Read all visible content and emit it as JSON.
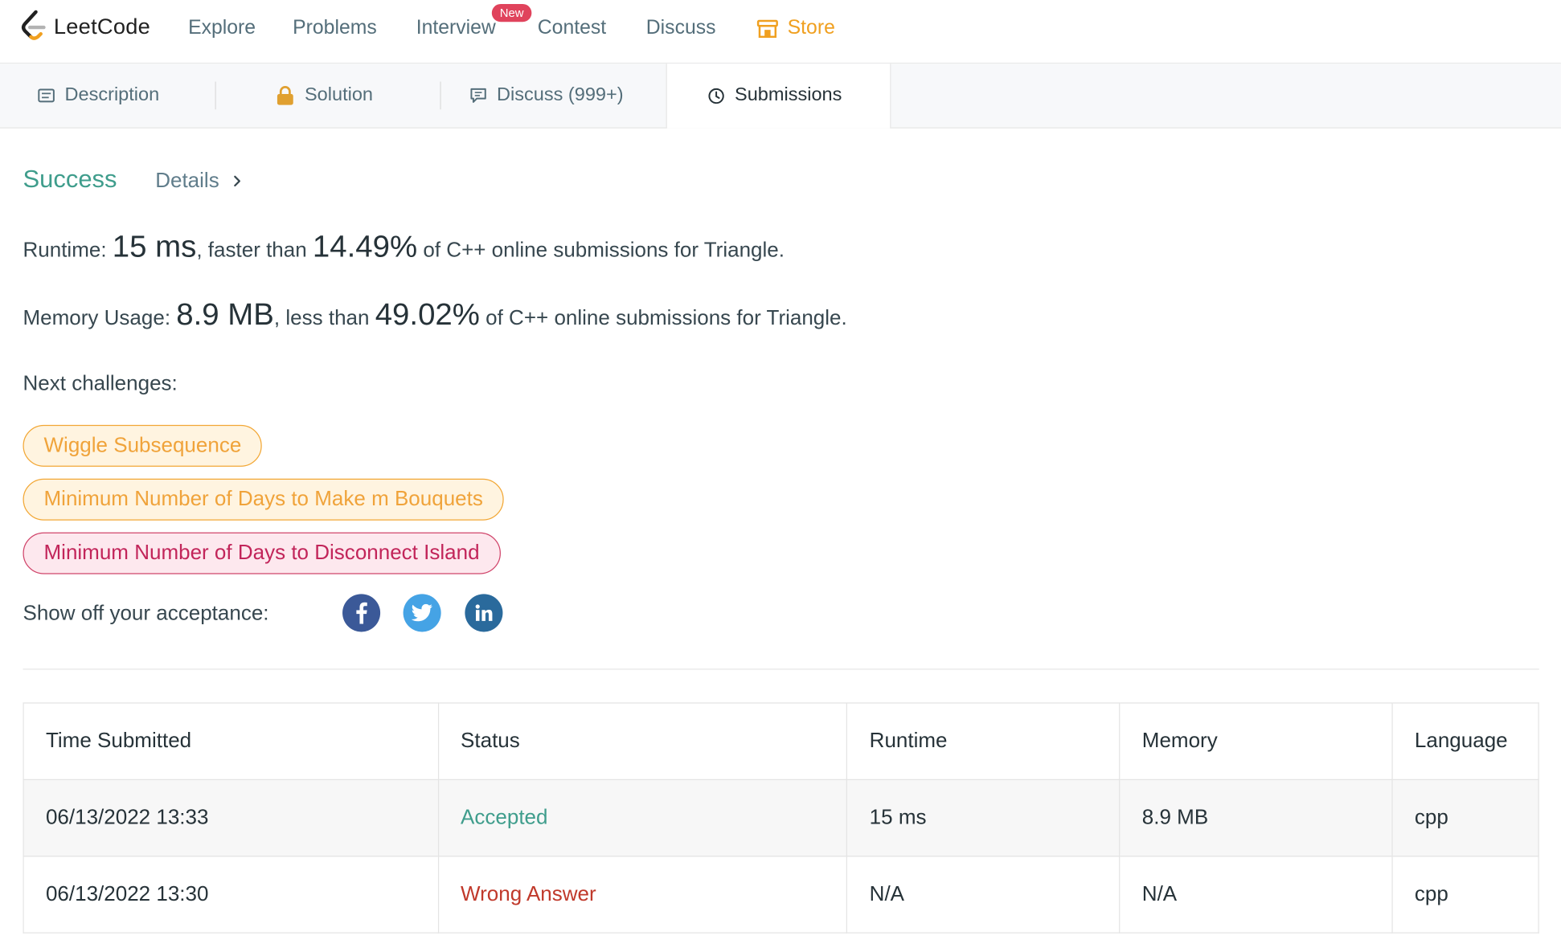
{
  "brand": {
    "name": "LeetCode"
  },
  "nav": {
    "items": [
      "Explore",
      "Problems",
      "Interview",
      "Contest",
      "Discuss"
    ],
    "badge": "New",
    "store": "Store"
  },
  "tabs": {
    "description": "Description",
    "solution": "Solution",
    "discuss": "Discuss (999+)",
    "submissions": "Submissions"
  },
  "result": {
    "status": "Success",
    "details": "Details"
  },
  "runtime": {
    "label": "Runtime: ",
    "value": "15 ms",
    "mid": ", faster than ",
    "percent": "14.49%",
    "tail": " of C++ online submissions for Triangle."
  },
  "memory": {
    "label": "Memory Usage: ",
    "value": "8.9 MB",
    "mid": ", less than ",
    "percent": "49.02%",
    "tail": " of C++ online submissions for Triangle."
  },
  "next_challenges": {
    "label": "Next challenges:",
    "items": [
      {
        "title": "Wiggle Subsequence",
        "difficulty_color": "#f0a33a"
      },
      {
        "title": "Minimum Number of Days to Make m Bouquets",
        "difficulty_color": "#f0a33a"
      },
      {
        "title": "Minimum Number of Days to Disconnect Island",
        "difficulty_color": "#c2255a"
      }
    ]
  },
  "share": {
    "label": "Show off your acceptance:",
    "networks": [
      "facebook-icon",
      "twitter-icon",
      "linkedin-icon"
    ]
  },
  "submissions_table": {
    "headers": [
      "Time Submitted",
      "Status",
      "Runtime",
      "Memory",
      "Language"
    ],
    "rows": [
      [
        "06/13/2022 13:33",
        "Accepted",
        "15 ms",
        "8.9 MB",
        "cpp"
      ],
      [
        "06/13/2022 13:30",
        "Wrong Answer",
        "N/A",
        "N/A",
        "cpp"
      ]
    ]
  },
  "colors": {
    "accent_success": "#3f9d8c",
    "error": "#c0392b",
    "store": "#f0a020"
  }
}
